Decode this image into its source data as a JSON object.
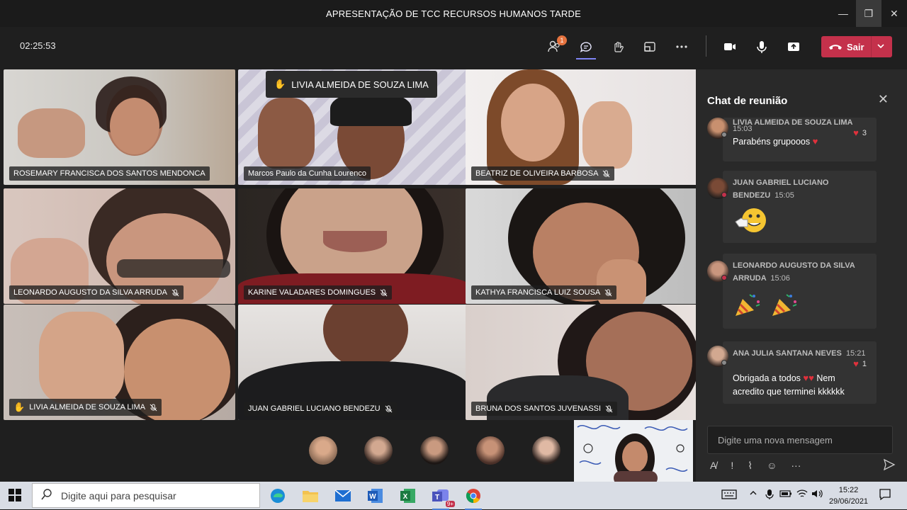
{
  "window": {
    "title": "APRESENTAÇÃO DE TCC RECURSOS HUMANOS TARDE"
  },
  "toolbar": {
    "timer": "02:25:53",
    "participants_badge": "1",
    "leave_label": "Sair"
  },
  "raised_hand_banner": "LIVIA ALMEIDA DE SOUZA LIMA",
  "tiles": [
    {
      "name": "ROSEMARY FRANCISCA DOS SANTOS MENDONCA",
      "muted": false,
      "hand": false
    },
    {
      "name": "Marcos Paulo da Cunha Lourenco",
      "muted": false,
      "hand": false
    },
    {
      "name": "BEATRIZ DE OLIVEIRA BARBOSA",
      "muted": true,
      "hand": false
    },
    {
      "name": "LEONARDO AUGUSTO DA SILVA ARRUDA",
      "muted": true,
      "hand": false
    },
    {
      "name": "KARINE VALADARES DOMINGUES",
      "muted": true,
      "hand": false
    },
    {
      "name": "KATHYA FRANCISCA LUIZ SOUSA",
      "muted": true,
      "hand": false
    },
    {
      "name": "LIVIA ALMEIDA DE SOUZA LIMA",
      "muted": true,
      "hand": true
    },
    {
      "name": "JUAN GABRIEL LUCIANO BENDEZU",
      "muted": true,
      "hand": false
    },
    {
      "name": "BRUNA DOS SANTOS JUVENASSI",
      "muted": true,
      "hand": false
    }
  ],
  "chat": {
    "title": "Chat de reunião",
    "messages": [
      {
        "sender": "LIVIA ALMEIDA DE SOUZA LIMA",
        "time": "15:03",
        "text": "Parabéns grupooos",
        "reaction_count": "3"
      },
      {
        "sender": "JUAN GABRIEL LUCIANO BENDEZU",
        "time": "15:05",
        "text": ""
      },
      {
        "sender": "LEONARDO AUGUSTO DA SILVA ARRUDA",
        "time": "15:06",
        "text": ""
      },
      {
        "sender": "ANA JULIA SANTANA NEVES",
        "time": "15:21",
        "text_before": "Obrigada a todos",
        "text_after": "Nem acredito que terminei kkkkkk",
        "reaction_count": "1"
      }
    ],
    "compose_placeholder": "Digite uma nova mensagem"
  },
  "taskbar": {
    "search_placeholder": "Digite aqui para pesquisar",
    "teams_badge": "9+",
    "time": "15:22",
    "date": "29/06/2021"
  },
  "colors": {
    "accent": "#7f85f5",
    "leave": "#c4314b",
    "heart": "#e0313c",
    "hand": "#f3c35a"
  }
}
